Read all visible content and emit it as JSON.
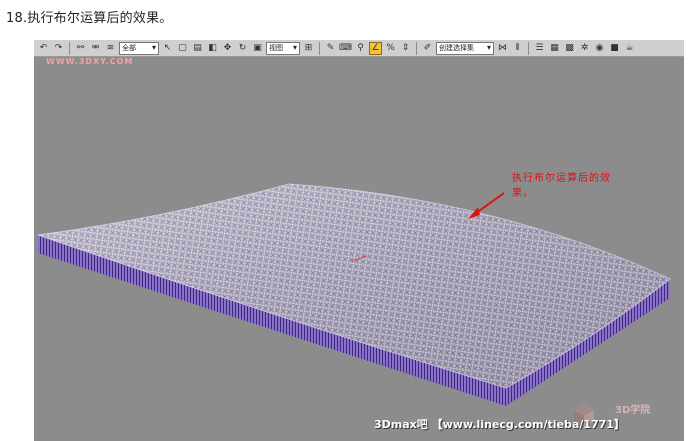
{
  "caption": "18.执行布尔运算后的效果。",
  "toolbar": {
    "selection_filter": "全部",
    "reference_coord": "视图",
    "named_selection": "创建选择集",
    "icons": [
      "undo-icon",
      "redo-icon",
      "link-icon",
      "unlink-icon",
      "bind-icon",
      "select-icon",
      "select-region-icon",
      "window-crossing-icon",
      "move-icon",
      "rotate-icon",
      "scale-icon",
      "pivot-icon",
      "mirror-icon",
      "snap-icon",
      "angle-snap-icon",
      "percent-snap-icon",
      "spinner-snap-icon",
      "edit-named-selection-icon",
      "align-icon",
      "layer-icon",
      "curve-editor-icon",
      "schematic-icon",
      "material-editor-icon",
      "render-setup-icon",
      "render-icon",
      "teapot-icon"
    ]
  },
  "logo": "WWW.3DXY.COM",
  "annotation": "执行布尔运算后的效果。",
  "watermark": "3Dmax吧 【www.linecg.com/tieba/1771】",
  "site_logo": "3D学院",
  "colors": {
    "viewport_bg": "#8c8c8c",
    "mesh_top": "#c9c3da",
    "mesh_side": "#7b5fc6",
    "annotation": "#e01010"
  }
}
